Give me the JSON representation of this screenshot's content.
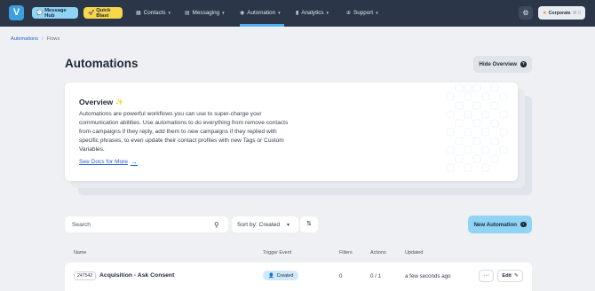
{
  "nav": {
    "logo_letter": "V",
    "message_hub": "Message Hub",
    "quick_blast": "Quick Blast",
    "items": [
      {
        "label": "Contacts",
        "icon": "contacts-icon"
      },
      {
        "label": "Messaging",
        "icon": "messaging-icon"
      },
      {
        "label": "Automation",
        "icon": "automation-icon"
      },
      {
        "label": "Analytics",
        "icon": "analytics-icon"
      },
      {
        "label": "Support",
        "icon": "support-icon"
      }
    ],
    "active": "Automation",
    "account_label": "Corporate",
    "account_shortcut": "⌘.0"
  },
  "breadcrumb": {
    "link": "Automations",
    "separator": "/",
    "current": "Flows"
  },
  "page": {
    "title": "Automations",
    "hide_overview": "Hide Overview"
  },
  "overview": {
    "title": "Overview",
    "body": "Automations are powerful workflows you can use to super-charge your communication abilities. Use automations to do everything from remove contacts from campaigns if they reply, add them to new campaigns if they replied with specific phrases, to even update their contact profiles with new Tags or Custom Variables.",
    "link": "See Docs for More"
  },
  "toolbar": {
    "search_placeholder": "Search",
    "sort_label": "Sort by: Created",
    "new_automation": "New Automation"
  },
  "table": {
    "columns": [
      "Name",
      "Trigger Event",
      "Filters",
      "Actions",
      "Updated"
    ],
    "rows": [
      {
        "id": "247542",
        "name": "Acquisition - Ask Consent",
        "trigger": "Created",
        "filters": "0",
        "actions": "0 / 1",
        "updated": "a few seconds ago",
        "edit": "Edit"
      }
    ]
  },
  "colors": {
    "nav_bg": "#2b3648",
    "accent_blue": "#8fd3f5",
    "accent_yellow": "#f7d84a",
    "link": "#2563c9"
  }
}
